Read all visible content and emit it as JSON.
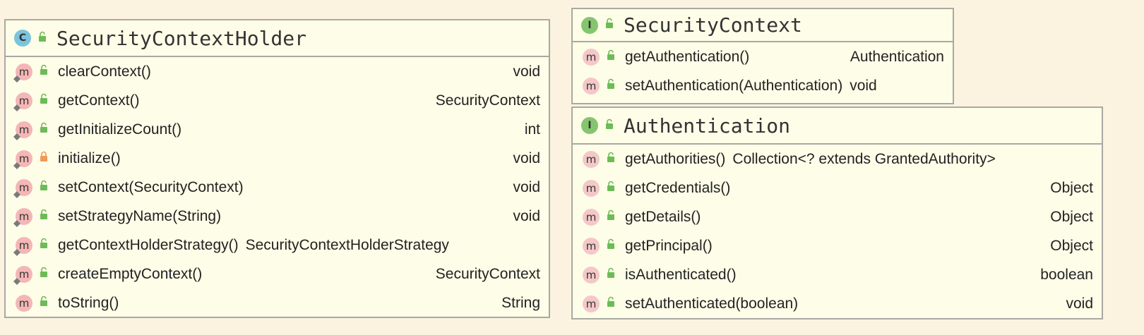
{
  "holder": {
    "title": "SecurityContextHolder",
    "kind": "C",
    "methods": [
      {
        "name": "clearContext()",
        "type": "void"
      },
      {
        "name": "getContext()",
        "type": "SecurityContext"
      },
      {
        "name": "getInitializeCount()",
        "type": "int"
      },
      {
        "name": "initialize()",
        "type": "void"
      },
      {
        "name": "setContext(SecurityContext)",
        "type": "void"
      },
      {
        "name": "setStrategyName(String)",
        "type": "void"
      },
      {
        "name": "getContextHolderStrategy()",
        "type": "SecurityContextHolderStrategy"
      },
      {
        "name": "createEmptyContext()",
        "type": "SecurityContext"
      },
      {
        "name": "toString()",
        "type": "String"
      }
    ]
  },
  "ctx": {
    "title": "SecurityContext",
    "kind": "I",
    "methods": [
      {
        "name": "getAuthentication()",
        "type": "Authentication"
      },
      {
        "name": "setAuthentication(Authentication)",
        "type": "void"
      }
    ]
  },
  "auth": {
    "title": "Authentication",
    "kind": "I",
    "methods": [
      {
        "name": "getAuthorities()",
        "type": "Collection<? extends GrantedAuthority>"
      },
      {
        "name": "getCredentials()",
        "type": "Object"
      },
      {
        "name": "getDetails()",
        "type": "Object"
      },
      {
        "name": "getPrincipal()",
        "type": "Object"
      },
      {
        "name": "isAuthenticated()",
        "type": "boolean"
      },
      {
        "name": "setAuthenticated(boolean)",
        "type": "void"
      }
    ]
  },
  "badge": {
    "method": "m"
  },
  "colors": {
    "background": "#fbf3e0",
    "box_fill": "#fefde8",
    "border": "#a9a9a3",
    "class_badge": "#7cc4dc",
    "interface_badge": "#86c56f",
    "method_badge": "#f4b6b6",
    "public_lock": "#6dbb57",
    "private_lock": "#ef9b55"
  }
}
